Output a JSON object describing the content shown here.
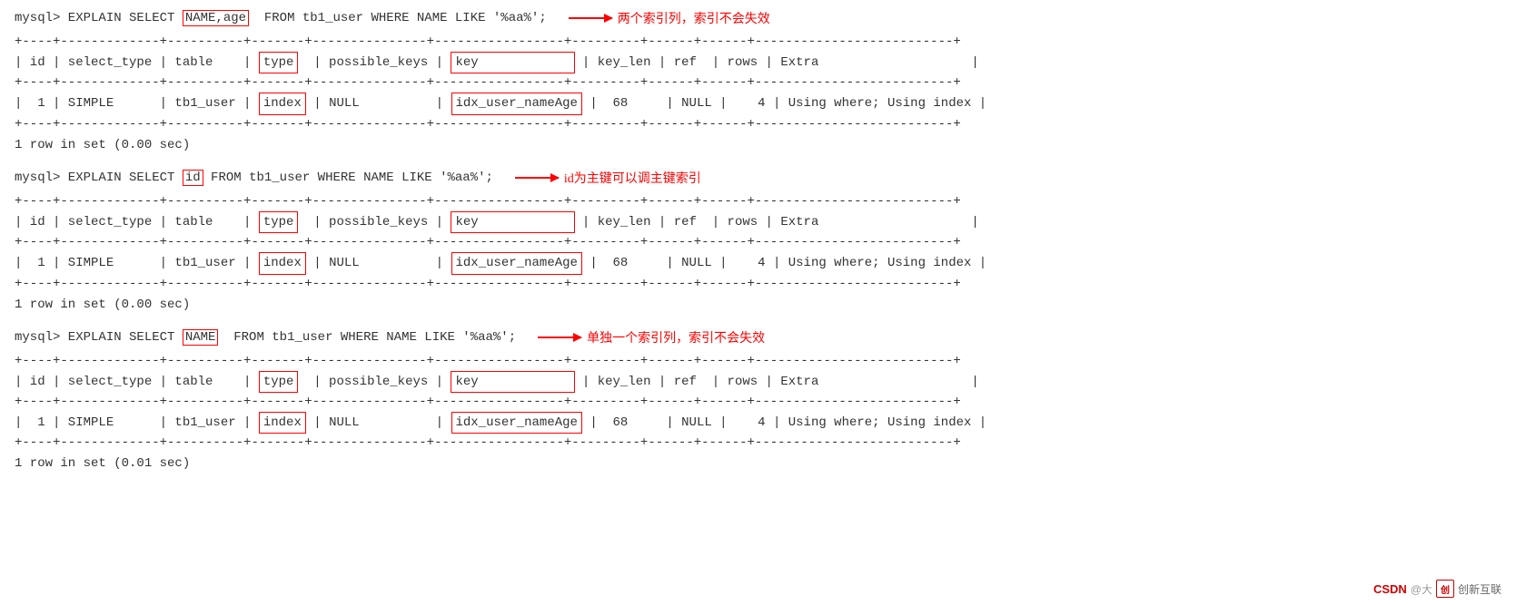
{
  "sections": [
    {
      "id": "section1",
      "query_prefix": "mysql> EXPLAIN SELECT ",
      "query_highlight": "NAME,age",
      "query_suffix": "  FROM tb1_user WHERE NAME LIKE '%aa%';",
      "annotation": "两个索引列，索引不会失效",
      "table": {
        "separator": "+----+-------------+----------+-------+---------------+-----------------+---------+------+------+--------------------------+",
        "header": "| id | select_type | table    | type  | possible_keys | key             | key_len | ref  | rows | Extra                    |",
        "data_row": "|  1 | SIMPLE      | tb1_user | index | NULL          | idx_user_nameAge|  68     | NULL |    4 | Using where; Using index |"
      },
      "result": "1 row in set (0.00 sec)"
    },
    {
      "id": "section2",
      "query_prefix": "mysql> EXPLAIN SELECT ",
      "query_highlight": "id",
      "query_suffix": " FROM tb1_user WHERE NAME LIKE '%aa%';",
      "annotation": "id为主键可以调主键索引",
      "table": {
        "separator": "+----+-------------+----------+-------+---------------+-----------------+---------+------+------+--------------------------+",
        "header": "| id | select_type | table    | type  | possible_keys | key             | key_len | ref  | rows | Extra                    |",
        "data_row": "|  1 | SIMPLE      | tb1_user | index | NULL          | idx_user_nameAge|  68     | NULL |    4 | Using where; Using index |"
      },
      "result": "1 row in set (0.00 sec)"
    },
    {
      "id": "section3",
      "query_prefix": "mysql> EXPLAIN SELECT ",
      "query_highlight": "NAME",
      "query_suffix": "  FROM tb1_user WHERE NAME LIKE '%aa%';",
      "annotation": "单独一个索引列，索引不会失效",
      "table": {
        "separator": "+----+-------------+----------+-------+---------------+-----------------+---------+------+------+--------------------------+",
        "header": "| id | select_type | table    | type  | possible_keys | key             | key_len | ref  | rows | Extra                    |",
        "data_row": "|  1 | SIMPLE      | tb1_user | index | NULL          | idx_user_nameAge|  68     | NULL |    4 | Using where; Using index |"
      },
      "result": "1 row in set (0.01 sec)"
    }
  ],
  "watermark": {
    "csdn": "CSDN",
    "at": "@大",
    "brand": "创新互联"
  }
}
